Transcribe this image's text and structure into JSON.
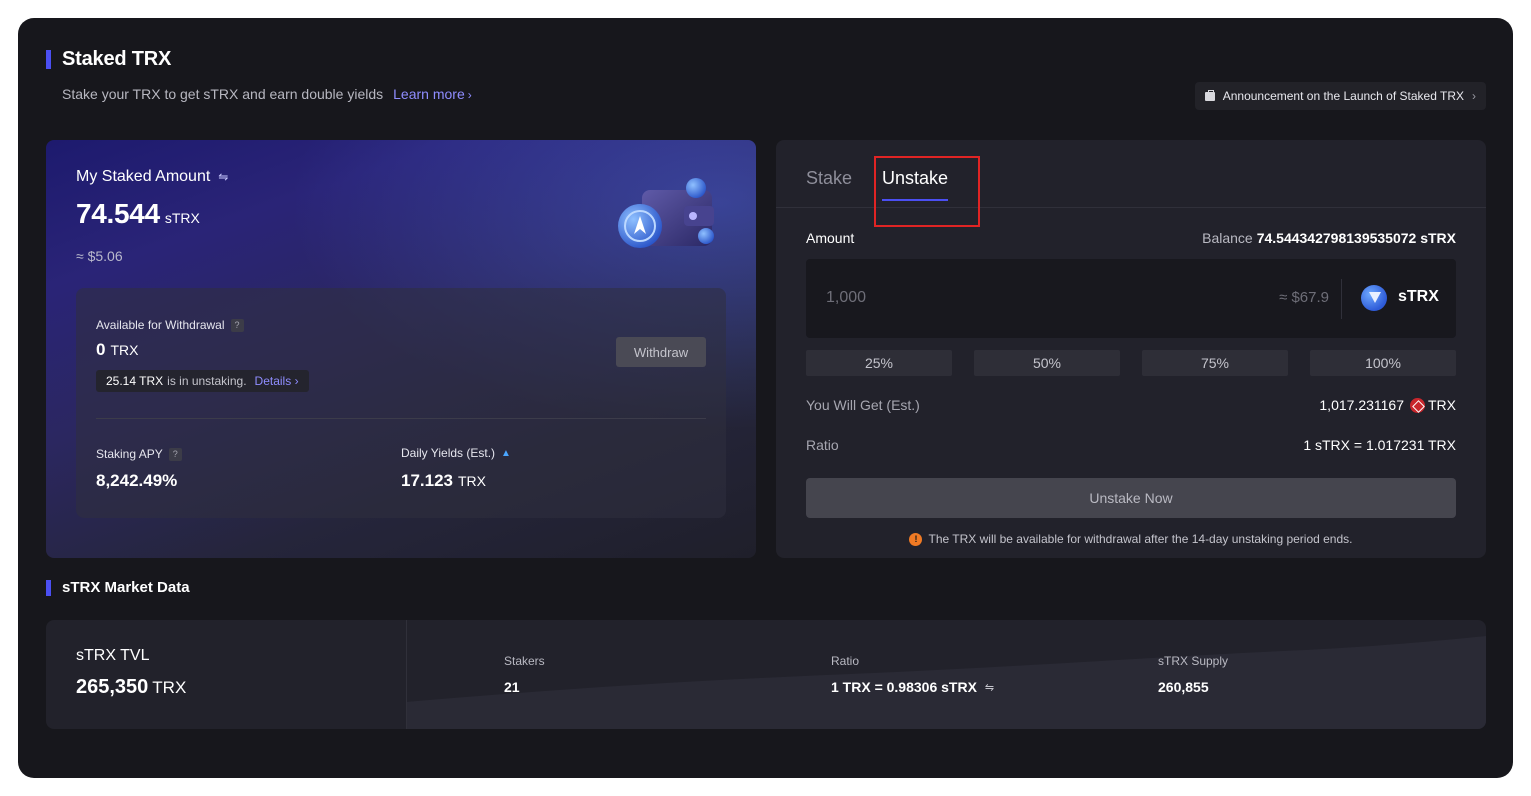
{
  "header": {
    "title": "Staked TRX",
    "subtitle": "Stake your TRX to get sTRX and earn double yields",
    "learn_more": "Learn more",
    "announcement": "Announcement on the Launch of Staked TRX"
  },
  "my_staked": {
    "label": "My Staked Amount",
    "amount": "74.544",
    "unit": "sTRX",
    "usd": "≈ $5.06",
    "available_label": "Available for Withdrawal",
    "available_value": "0",
    "available_unit": "TRX",
    "unstaking_amount": "25.14 TRX",
    "unstaking_text": "is in unstaking.",
    "details_label": "Details",
    "withdraw_label": "Withdraw",
    "apy_label": "Staking APY",
    "apy_value": "8,242.49%",
    "daily_label": "Daily Yields (Est.)",
    "daily_value": "17.123",
    "daily_unit": "TRX"
  },
  "unstake_panel": {
    "tabs": [
      "Stake",
      "Unstake"
    ],
    "active_tab": "Unstake",
    "amount_label": "Amount",
    "balance_label": "Balance",
    "balance_value": "74.544342798139535072 sTRX",
    "amount_placeholder": "1,000",
    "amount_usd": "≈ $67.9",
    "token": "sTRX",
    "percent_options": [
      "25%",
      "50%",
      "75%",
      "100%"
    ],
    "get_label": "You Will Get (Est.)",
    "get_value": "1,017.231167",
    "get_unit": "TRX",
    "ratio_label": "Ratio",
    "ratio_value": "1 sTRX = 1.017231 TRX",
    "unstake_button": "Unstake Now",
    "notice": "The TRX will be available for withdrawal after the 14-day unstaking period ends."
  },
  "market": {
    "title": "sTRX Market Data",
    "tvl_label": "sTRX TVL",
    "tvl_value": "265,350",
    "tvl_unit": "TRX",
    "stats": [
      {
        "label": "Stakers",
        "value": "21"
      },
      {
        "label": "Ratio",
        "value": "1 TRX = 0.98306 sTRX"
      },
      {
        "label": "sTRX Supply",
        "value": "260,855"
      }
    ]
  },
  "colors": {
    "accent": "#4b4ff2",
    "link": "#8f8dff",
    "warning": "#f07a24",
    "highlight_border": "#e02424"
  }
}
